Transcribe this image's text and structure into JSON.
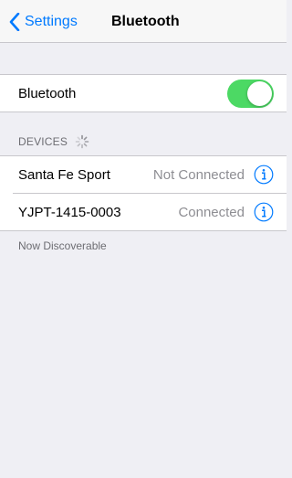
{
  "nav": {
    "back_label": "Settings",
    "title": "Bluetooth"
  },
  "bluetooth": {
    "label": "Bluetooth",
    "enabled": true,
    "toggle_color": "#4cd964"
  },
  "devices": {
    "header": "DEVICES",
    "items": [
      {
        "name": "Santa Fe Sport",
        "status": "Not Connected"
      },
      {
        "name": "YJPT-1415-0003",
        "status": "Connected"
      }
    ]
  },
  "footer": "Now Discoverable",
  "colors": {
    "accent": "#007aff",
    "background": "#efeff4"
  }
}
